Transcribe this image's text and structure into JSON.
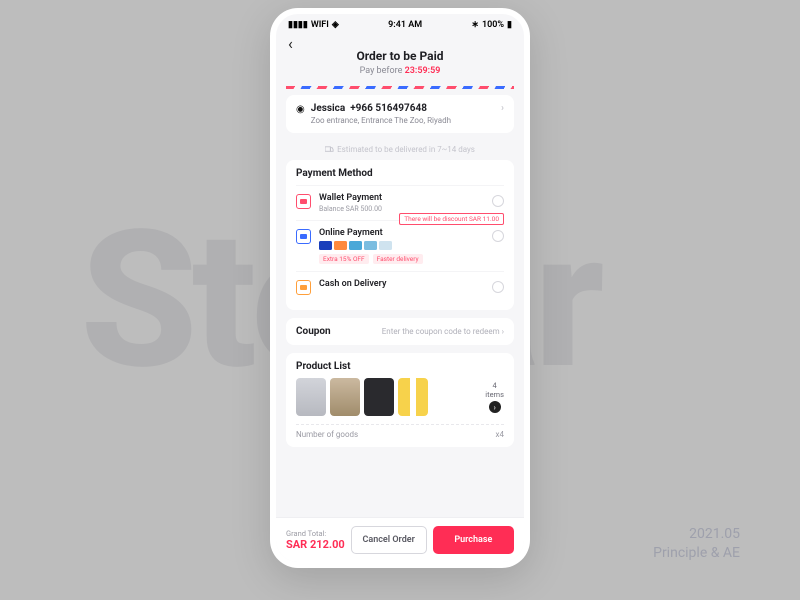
{
  "bg_word": "Stellar",
  "caption": {
    "date": "2021.05",
    "tool": "Principle & AE"
  },
  "status": {
    "wifi": "WIFI",
    "time": "9:41 AM",
    "battery": "100%"
  },
  "header": {
    "title": "Order to be Paid",
    "subtitle_prefix": "Pay before ",
    "countdown": "23:59:59"
  },
  "address": {
    "name": "Jessica",
    "phone": "+966 516497648",
    "line": "Zoo entrance, Entrance The Zoo, Riyadh"
  },
  "eta": "Estimated to be delivered in 7~14 days",
  "payment": {
    "section": "Payment Method",
    "wallet": {
      "label": "Wallet Payment",
      "balance": "Balance SAR 500.00"
    },
    "online": {
      "label": "Online Payment",
      "discount_bubble": "There will be discount SAR 11.00",
      "tags": [
        "Extra 15% OFF",
        "Faster delivery"
      ]
    },
    "cod": {
      "label": "Cash on Delivery"
    }
  },
  "coupon": {
    "label": "Coupon",
    "hint": "Enter the coupon code to redeem"
  },
  "products": {
    "section": "Product List",
    "count_label": "4\nitems",
    "goods_label": "Number of goods",
    "goods_qty": "x4"
  },
  "footer": {
    "total_label": "Grand Total:",
    "total_amount": "SAR 212.00",
    "cancel": "Cancel Order",
    "purchase": "Purchase"
  }
}
